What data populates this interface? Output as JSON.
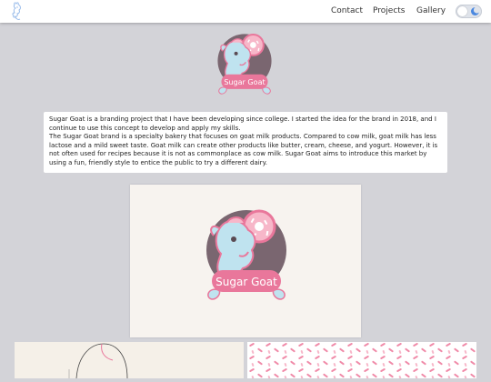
{
  "nav": {
    "logo_icon": "goat-outline-icon",
    "links": [
      "Contact",
      "Projects",
      "Gallery"
    ],
    "theme_toggle_icon": "moon-icon"
  },
  "brand": {
    "name": "Sugar Goat"
  },
  "intro": {
    "paragraph1": "Sugar Goat is a branding project that I have been developing since college. I started the idea for the brand in 2018, and I continue to use this concept to develop and apply my skills.",
    "paragraph2": "The Sugar Goat brand is a specialty bakery that focuses on goat milk products. Compared to cow milk, goat milk has less lactose and a mild sweet taste. Goat milk can create other products like butter, cream, cheese, and yogurt. However, it is not often used for recipes because it is not as commonplace as cow milk. Sugar Goat aims to introduce this market by using a fun, friendly style to entice the public to try a different dairy."
  },
  "colors": {
    "pink": "#e9779b",
    "light_pink": "#f7b7c9",
    "goat_blue": "#bfe3ef",
    "plum": "#7a6670",
    "page_bg": "#d3d3d8"
  }
}
